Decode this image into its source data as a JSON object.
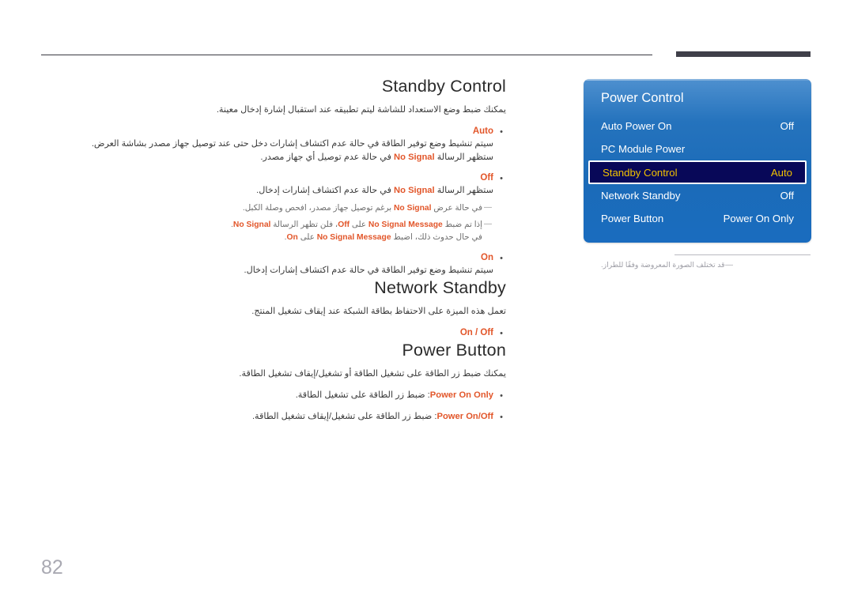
{
  "page": {
    "number": "82",
    "colors": {
      "accent_orange": "#e2562a",
      "osd_blue_top": "#4e90cf",
      "osd_blue_bottom": "#1a6cbf",
      "osd_selected_bg": "#080858",
      "osd_selected_text": "#f2c200",
      "rule_dark": "#3f3f49",
      "page_number": "#a9a9b2"
    }
  },
  "sections": {
    "standby_control": {
      "title": "Standby Control",
      "intro": "يمكنك ضبط وضع الاستعداد للشاشة ليتم تطبيقه عند استقبال إشارة إدخال معينة.",
      "bullets": [
        {
          "marker": "•",
          "label": "Auto",
          "lines": [
            "سيتم تنشيط وضع توفير الطاقة في حالة عدم اكتشاف إشارات دخل حتى عند توصيل جهاز مصدر بشاشة العرض.",
            "ستظهر الرسالة No Signal في حالة عدم توصيل أي جهاز مصدر."
          ],
          "line2_pre": "ستظهر الرسالة ",
          "line2_kw": "No Signal",
          "line2_post": " في حالة عدم توصيل أي جهاز مصدر."
        },
        {
          "marker": "•",
          "label": "Off",
          "line_pre": "ستظهر الرسالة ",
          "line_kw": "No Signal",
          "line_post": " في حالة عدم اكتشاف إشارات إدخال.",
          "notes": [
            {
              "dash": "—",
              "pre": "في حالة عرض ",
              "kw": "No Signal",
              "post": " برغم توصيل جهاز مصدر، افحص وصلة الكبل."
            },
            {
              "dash": "—",
              "pre": "إذا تم ضبط ",
              "kw1": "No Signal Message",
              "mid1": " على ",
              "kw2": "Off",
              "mid2": "، فلن تظهر الرسالة ",
              "kw3": "No Signal",
              "post": ".",
              "line2_pre": "في حال حدوث ذلك، اضبط ",
              "line2_kw1": "No Signal Message",
              "line2_mid": " على ",
              "line2_kw2": "On",
              "line2_post": "."
            }
          ]
        },
        {
          "marker": "•",
          "label": "On",
          "lines": [
            "سيتم تنشيط وضع توفير الطاقة في حالة عدم اكتشاف إشارات إدخال."
          ]
        }
      ]
    },
    "network_standby": {
      "title": "Network Standby",
      "intro": "تعمل هذه الميزة على الاحتفاظ بطاقة الشبكة عند إيقاف تشغيل المنتج.",
      "bullets": [
        {
          "marker": "•",
          "label": "On / Off"
        }
      ]
    },
    "power_button": {
      "title": "Power Button",
      "intro": "يمكنك ضبط زر الطاقة على تشغيل الطاقة أو تشغيل/إيقاف تشغيل الطاقة.",
      "bullets": [
        {
          "marker": "•",
          "label": "Power On Only",
          "desc": ": ضبط زر الطاقة على تشغيل الطاقة."
        },
        {
          "marker": "•",
          "label": "Power On/Off",
          "desc": ": ضبط زر الطاقة على تشغيل/إيقاف تشغيل الطاقة."
        }
      ]
    }
  },
  "osd": {
    "title": "Power Control",
    "rows": [
      {
        "label": "Auto Power On",
        "value": "Off",
        "selected": false
      },
      {
        "label": "PC Module Power",
        "value": "",
        "selected": false
      },
      {
        "label": "Standby Control",
        "value": "Auto",
        "selected": true
      },
      {
        "label": "Network Standby",
        "value": "Off",
        "selected": false
      },
      {
        "label": "Power Button",
        "value": "Power On Only",
        "selected": false
      }
    ]
  },
  "footnote": {
    "dash": "―",
    "text": "قد تختلف الصورة المعروضة وفقًا للطراز."
  }
}
